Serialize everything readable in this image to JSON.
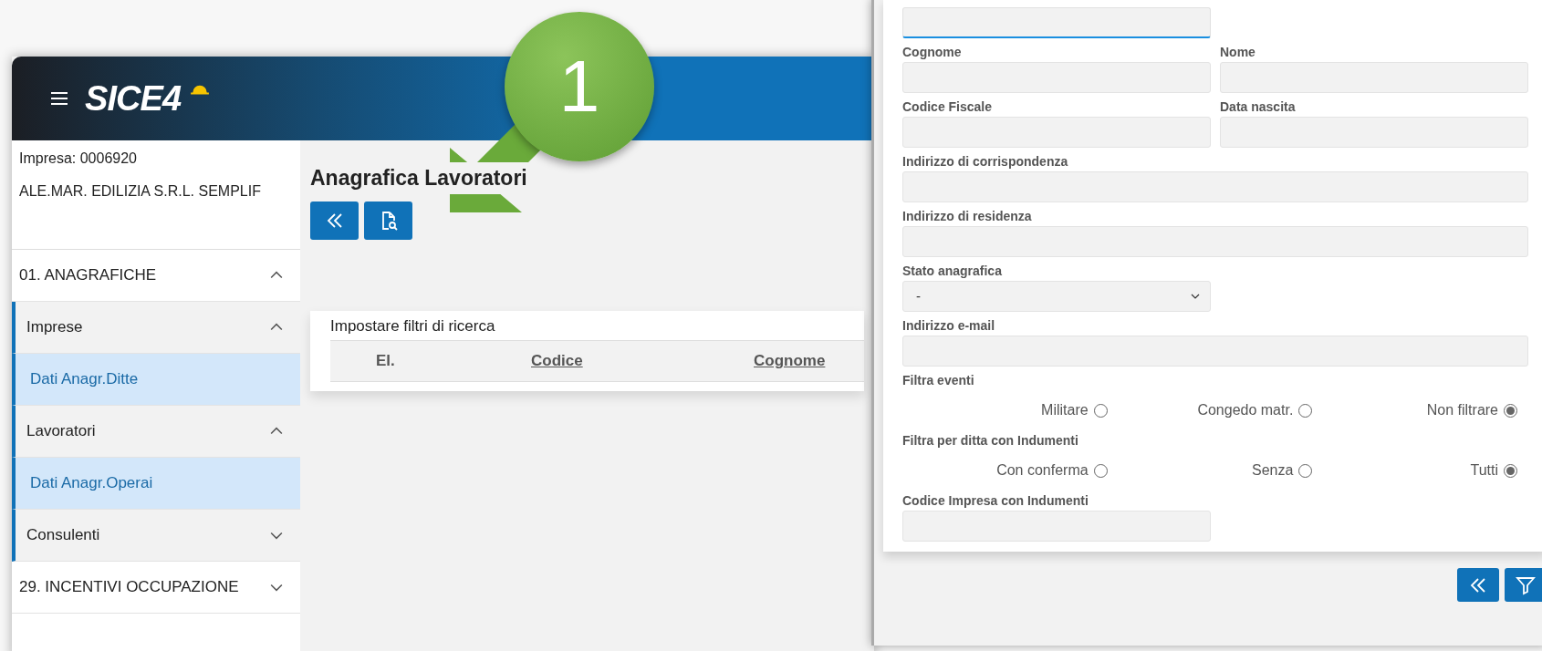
{
  "app": {
    "logo": "SICE4"
  },
  "company": {
    "code": "Impresa: 0006920",
    "name": "ALE.MAR. EDILIZIA S.R.L. SEMPLIF"
  },
  "sidebar": {
    "items": [
      {
        "label": "01. ANAGRAFICHE",
        "expanded": true,
        "children": [
          {
            "label": "Imprese",
            "expanded": true,
            "children": [
              {
                "label": "Dati Anagr.Ditte",
                "selected": true
              }
            ]
          },
          {
            "label": "Lavoratori",
            "expanded": true,
            "children": [
              {
                "label": "Dati Anagr.Operai",
                "selected": true
              }
            ]
          },
          {
            "label": "Consulenti",
            "expanded": false
          }
        ]
      },
      {
        "label": "29. INCENTIVI OCCUPAZIONE",
        "expanded": false
      }
    ]
  },
  "page": {
    "title": "Anagrafica Lavoratori",
    "toolbar": [
      {
        "kind": "back"
      },
      {
        "kind": "search-document"
      }
    ]
  },
  "results": {
    "caption": "Impostare filtri di ricerca",
    "columns": [
      {
        "label": "El.",
        "sortable": false
      },
      {
        "label": "Codice",
        "sortable": true
      },
      {
        "label": "Cognome",
        "sortable": true
      }
    ]
  },
  "filter_form": {
    "rows": [
      {
        "fields": [
          {
            "kind": "text",
            "focused": true,
            "wide": false
          }
        ]
      },
      {
        "fields": [
          {
            "kind": "text",
            "label": "Cognome",
            "focused": false,
            "wide": false
          },
          {
            "kind": "text",
            "label": "Nome",
            "focused": false,
            "wide": false
          }
        ]
      },
      {
        "fields": [
          {
            "kind": "text",
            "label": "Codice Fiscale",
            "focused": false,
            "wide": false
          },
          {
            "kind": "text",
            "label": "Data nascita",
            "focused": false,
            "wide": false
          }
        ]
      },
      {
        "fields": [
          {
            "kind": "text",
            "label": "Indirizzo di corrispondenza",
            "focused": false,
            "wide": true
          }
        ]
      },
      {
        "fields": [
          {
            "kind": "text",
            "label": "Indirizzo di residenza",
            "focused": false,
            "wide": true
          }
        ]
      },
      {
        "fields": [
          {
            "kind": "select",
            "label": "Stato anagrafica",
            "value": "-",
            "wide": false
          }
        ]
      },
      {
        "fields": [
          {
            "kind": "text",
            "label": "Indirizzo e-mail",
            "focused": false,
            "wide": true
          }
        ]
      },
      {
        "fields": [
          {
            "kind": "radio",
            "label": "Filtra eventi",
            "options": [
              {
                "label": "Militare",
                "selected": false
              },
              {
                "label": "Congedo matr.",
                "selected": false
              },
              {
                "label": "Non filtrare",
                "selected": true
              }
            ]
          }
        ]
      },
      {
        "fields": [
          {
            "kind": "radio",
            "label": "Filtra per ditta con Indumenti",
            "options": [
              {
                "label": "Con conferma",
                "selected": false
              },
              {
                "label": "Senza",
                "selected": false
              },
              {
                "label": "Tutti",
                "selected": true
              }
            ]
          }
        ]
      },
      {
        "fields": [
          {
            "kind": "text",
            "label": "Codice Impresa con Indumenti",
            "focused": false,
            "wide": false
          }
        ]
      }
    ]
  },
  "dialog_toolbar": [
    {
      "kind": "back"
    },
    {
      "kind": "filter"
    }
  ],
  "annotation": {
    "number": "1"
  }
}
